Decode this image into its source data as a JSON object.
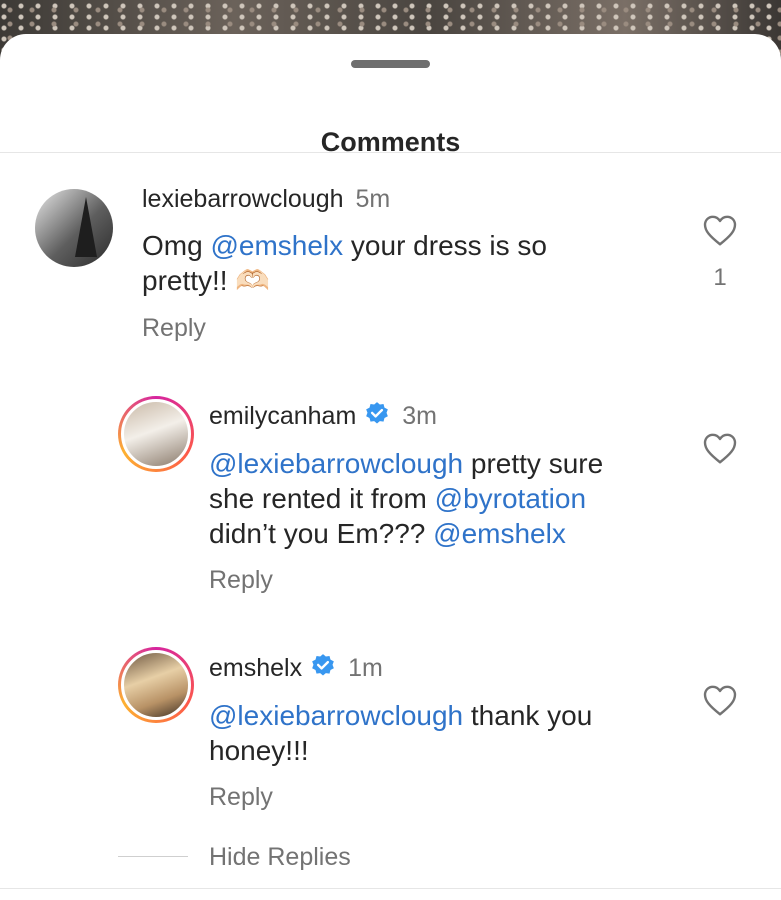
{
  "sheet": {
    "title": "Comments"
  },
  "comments": [
    {
      "username": "lexiebarrowclough",
      "time": "5m",
      "verified": false,
      "text_line1_plain": "Omg ",
      "text_line1_mention": "@emshelx",
      "text_line1_rest": " your dress is so",
      "text_line2": "pretty!! 🫶🏻",
      "reply_label": "Reply",
      "like_count": "1"
    },
    {
      "username": "emilycanham",
      "time": "3m",
      "verified": true,
      "mention1": "@lexiebarrowclough",
      "text_line1_rest": " pretty sure",
      "text_line2_plain": "she rented it from ",
      "mention2": "@byrotation",
      "text_line3_plain": "didn’t you Em??? ",
      "mention3": "@emshelx",
      "reply_label": "Reply"
    },
    {
      "username": "emshelx",
      "time": "1m",
      "verified": true,
      "mention1": "@lexiebarrowclough",
      "text_line1_rest": " thank you",
      "text_line2": "honey!!!",
      "reply_label": "Reply"
    }
  ],
  "hide_replies_label": "Hide Replies",
  "colors": {
    "mention": "#2f73c9",
    "verified": "#3897f0",
    "muted": "#737373"
  },
  "icons": {
    "like": "heart-outline-icon",
    "verified": "verified-badge-icon"
  }
}
